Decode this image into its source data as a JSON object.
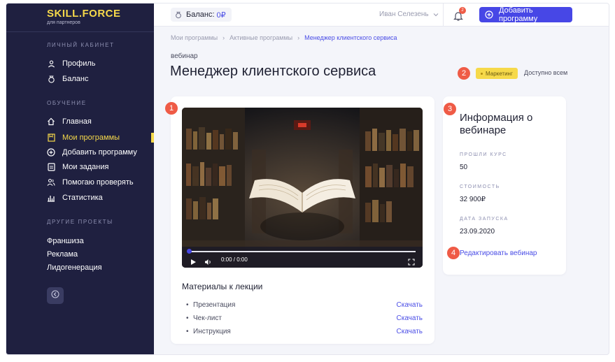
{
  "sidebar": {
    "logo_title": "SKILL.FORCE",
    "logo_subtitle": "для партнеров",
    "sections": [
      {
        "title": "ЛИЧНЫЙ КАБИНЕТ"
      },
      {
        "title": "ОБУЧЕНИЕ"
      },
      {
        "title": "ДРУГИЕ ПРОЕКТЫ"
      }
    ],
    "account_items": [
      {
        "label": "Профиль",
        "icon": "user-icon"
      },
      {
        "label": "Баланс",
        "icon": "wallet-icon"
      }
    ],
    "learning_items": [
      {
        "label": "Главная",
        "icon": "home-icon"
      },
      {
        "label": "Мои программы",
        "icon": "bookmark-icon",
        "active": true
      },
      {
        "label": "Добавить программу",
        "icon": "plus-circle-icon"
      },
      {
        "label": "Мои задания",
        "icon": "clipboard-icon"
      },
      {
        "label": "Помогаю проверять",
        "icon": "users-icon"
      },
      {
        "label": "Статистика",
        "icon": "chart-icon"
      }
    ],
    "other_items": [
      {
        "label": "Франшиза"
      },
      {
        "label": "Реклама"
      },
      {
        "label": "Лидогенерация"
      }
    ],
    "accent": "#f6d94a",
    "background": "#1f2040"
  },
  "header": {
    "balance_label": "Баланс:",
    "balance_value": "0₽",
    "user_name": "Иван Селезень",
    "notifications_count": "2",
    "add_program_label": "Добавить программу",
    "accent": "#4747e6"
  },
  "breadcrumb": [
    "Мои программы",
    "Активные программы",
    "Менеджер клиентского сервиса"
  ],
  "page": {
    "kind": "вебинар",
    "title": "Менеджер клиентского сервиса",
    "tag": "Маркетинг",
    "access": "Доступно всем"
  },
  "markers": [
    "1",
    "2",
    "3",
    "4"
  ],
  "video": {
    "time": "0:00 / 0:00",
    "progress": 0
  },
  "materials": {
    "title": "Материалы к лекции",
    "bullet": "•",
    "items": [
      {
        "name": "Презентация",
        "action": "Скачать"
      },
      {
        "name": "Чек-лист",
        "action": "Скачать"
      },
      {
        "name": "Инструкция",
        "action": "Скачать"
      }
    ]
  },
  "info": {
    "title": "Информация о вебинаре",
    "fields": [
      {
        "label": "ПРОШЛИ КУРС",
        "value": "50"
      },
      {
        "label": "СТОИМОСТЬ",
        "value": "32 900₽"
      },
      {
        "label": "ДАТА ЗАПУСКА",
        "value": "23.09.2020"
      }
    ],
    "edit_label": "Редактировать вебинар"
  }
}
